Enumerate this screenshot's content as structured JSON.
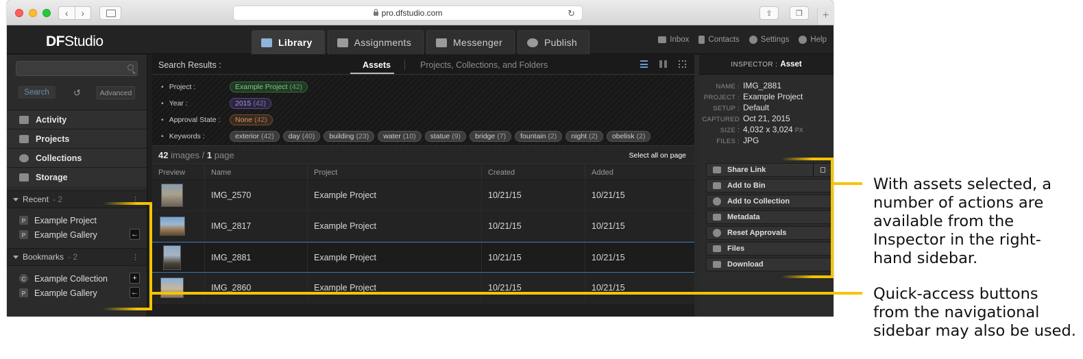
{
  "browser": {
    "url": "pro.dfstudio.com"
  },
  "app": {
    "logo_bold": "DF",
    "logo_rest": "Studio"
  },
  "main_tabs": [
    {
      "label": "Library",
      "active": true
    },
    {
      "label": "Assignments",
      "active": false
    },
    {
      "label": "Messenger",
      "active": false
    },
    {
      "label": "Publish",
      "active": false
    }
  ],
  "top_nav": [
    "Inbox",
    "Contacts",
    "Settings",
    "Help"
  ],
  "sidebar": {
    "search_button": "Search",
    "advanced_button": "Advanced",
    "items": [
      "Activity",
      "Projects",
      "Collections",
      "Storage"
    ],
    "recent": {
      "title": "Recent",
      "count": "- 2",
      "items": [
        {
          "badge": "P",
          "label": "Example Project"
        },
        {
          "badge": "P",
          "label": "Example Gallery"
        }
      ]
    },
    "bookmarks": {
      "title": "Bookmarks",
      "count": "- 2",
      "items": [
        {
          "badge": "C",
          "label": "Example Collection"
        },
        {
          "badge": "P",
          "label": "Example Gallery"
        }
      ]
    }
  },
  "results": {
    "title": "Search Results :",
    "tabs": [
      "Assets",
      "Projects, Collections, and Folders"
    ],
    "filters": {
      "project_label": "Project :",
      "project": {
        "name": "Example Project",
        "count": "(42)"
      },
      "year_label": "Year :",
      "year": {
        "name": "2015",
        "count": "(42)"
      },
      "approval_label": "Approval State :",
      "approval": {
        "name": "None",
        "count": "(42)"
      },
      "keywords_label": "Keywords :",
      "keywords": [
        {
          "name": "exterior",
          "count": "(42)"
        },
        {
          "name": "day",
          "count": "(40)"
        },
        {
          "name": "building",
          "count": "(23)"
        },
        {
          "name": "water",
          "count": "(10)"
        },
        {
          "name": "statue",
          "count": "(9)"
        },
        {
          "name": "bridge",
          "count": "(7)"
        },
        {
          "name": "fountain",
          "count": "(2)"
        },
        {
          "name": "night",
          "count": "(2)"
        },
        {
          "name": "obelisk",
          "count": "(2)"
        }
      ]
    },
    "count_num": "42",
    "count_unit": "images",
    "count_sep": "/",
    "page_num": "1",
    "page_unit": "page",
    "select_all": "Select all on page",
    "columns": [
      "Preview",
      "Name",
      "Project",
      "Created",
      "Added"
    ],
    "rows": [
      {
        "name": "IMG_2570",
        "project": "Example Project",
        "created": "10/21/15",
        "added": "10/21/15"
      },
      {
        "name": "IMG_2817",
        "project": "Example Project",
        "created": "10/21/15",
        "added": "10/21/15"
      },
      {
        "name": "IMG_2881",
        "project": "Example Project",
        "created": "10/21/15",
        "added": "10/21/15"
      },
      {
        "name": "IMG_2860",
        "project": "Example Project",
        "created": "10/21/15",
        "added": "10/21/15"
      }
    ]
  },
  "inspector": {
    "title": "INSPECTOR :",
    "title_value": "Asset",
    "meta": {
      "name_k": "NAME :",
      "name_v": "IMG_2881",
      "project_k": "PROJECT :",
      "project_v": "Example Project",
      "setup_k": "SETUP :",
      "setup_v": "Default",
      "captured_k": "CAPTURED :",
      "captured_v": "Oct 21, 2015",
      "size_k": "SIZE :",
      "size_v": "4,032 x 3,024",
      "size_unit": "PX",
      "files_k": "FILES :",
      "files_v": "JPG"
    },
    "actions": [
      "Share Link",
      "Add to Bin",
      "Add to Collection",
      "Metadata",
      "Reset Approvals",
      "Files",
      "Download"
    ]
  },
  "callouts": {
    "inspector_text": "With assets selected, a number of actions are available from the Inspector in the right-hand sidebar.",
    "sidebar_text": "Quick-access buttons from the navigational sidebar may also be used."
  },
  "colors": {
    "callout": "#f5c400",
    "selection": "#3a7ab0"
  }
}
